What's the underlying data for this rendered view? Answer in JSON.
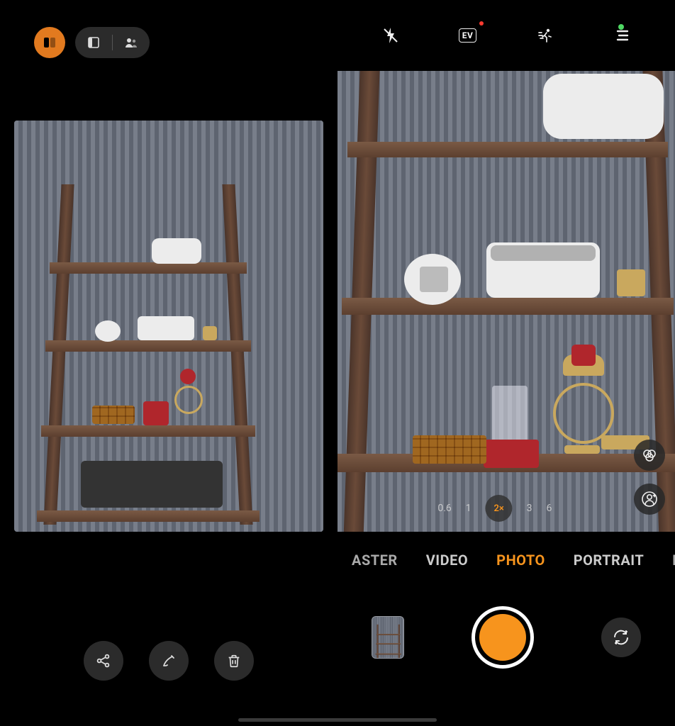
{
  "statusbar": {
    "camera_indicator_color": "#4fd964"
  },
  "left_pane": {
    "top_tool": {
      "selected_mode_icon": "split-view-icon",
      "pill": {
        "icon_a": "rectangle-icon",
        "icon_b": "person-icon"
      }
    },
    "bottom_tools": {
      "share": "share-icon",
      "edit": "edit-icon",
      "delete": "trash-icon"
    },
    "image_alt": "Wooden ladder shelf with VR headset, speaker, candle, crystal, boxes"
  },
  "right_pane": {
    "top_tools": {
      "flash": "flash-off-icon",
      "ev": "EV",
      "ev_has_dot": true,
      "motion": "motion-icon",
      "menu": "menu-icon"
    },
    "viewfinder_alt": "Zoomed wooden ladder shelf, VR headset on top, speaker and clock on second shelf, candle and red box on third",
    "zoom": {
      "levels": [
        "0.6",
        "1",
        "2×",
        "3",
        "6"
      ],
      "active_index": 2
    },
    "side_pills": {
      "filter": "filters-icon",
      "ai": "ai-portrait-icon"
    },
    "modes": [
      "ASTER",
      "VIDEO",
      "PHOTO",
      "PORTRAIT",
      "M"
    ],
    "modes_active_index": 2,
    "shutter": {
      "gallery_alt": "Last photo thumbnail",
      "shutter": "shutter-button",
      "switch": "switch-camera-icon"
    }
  }
}
